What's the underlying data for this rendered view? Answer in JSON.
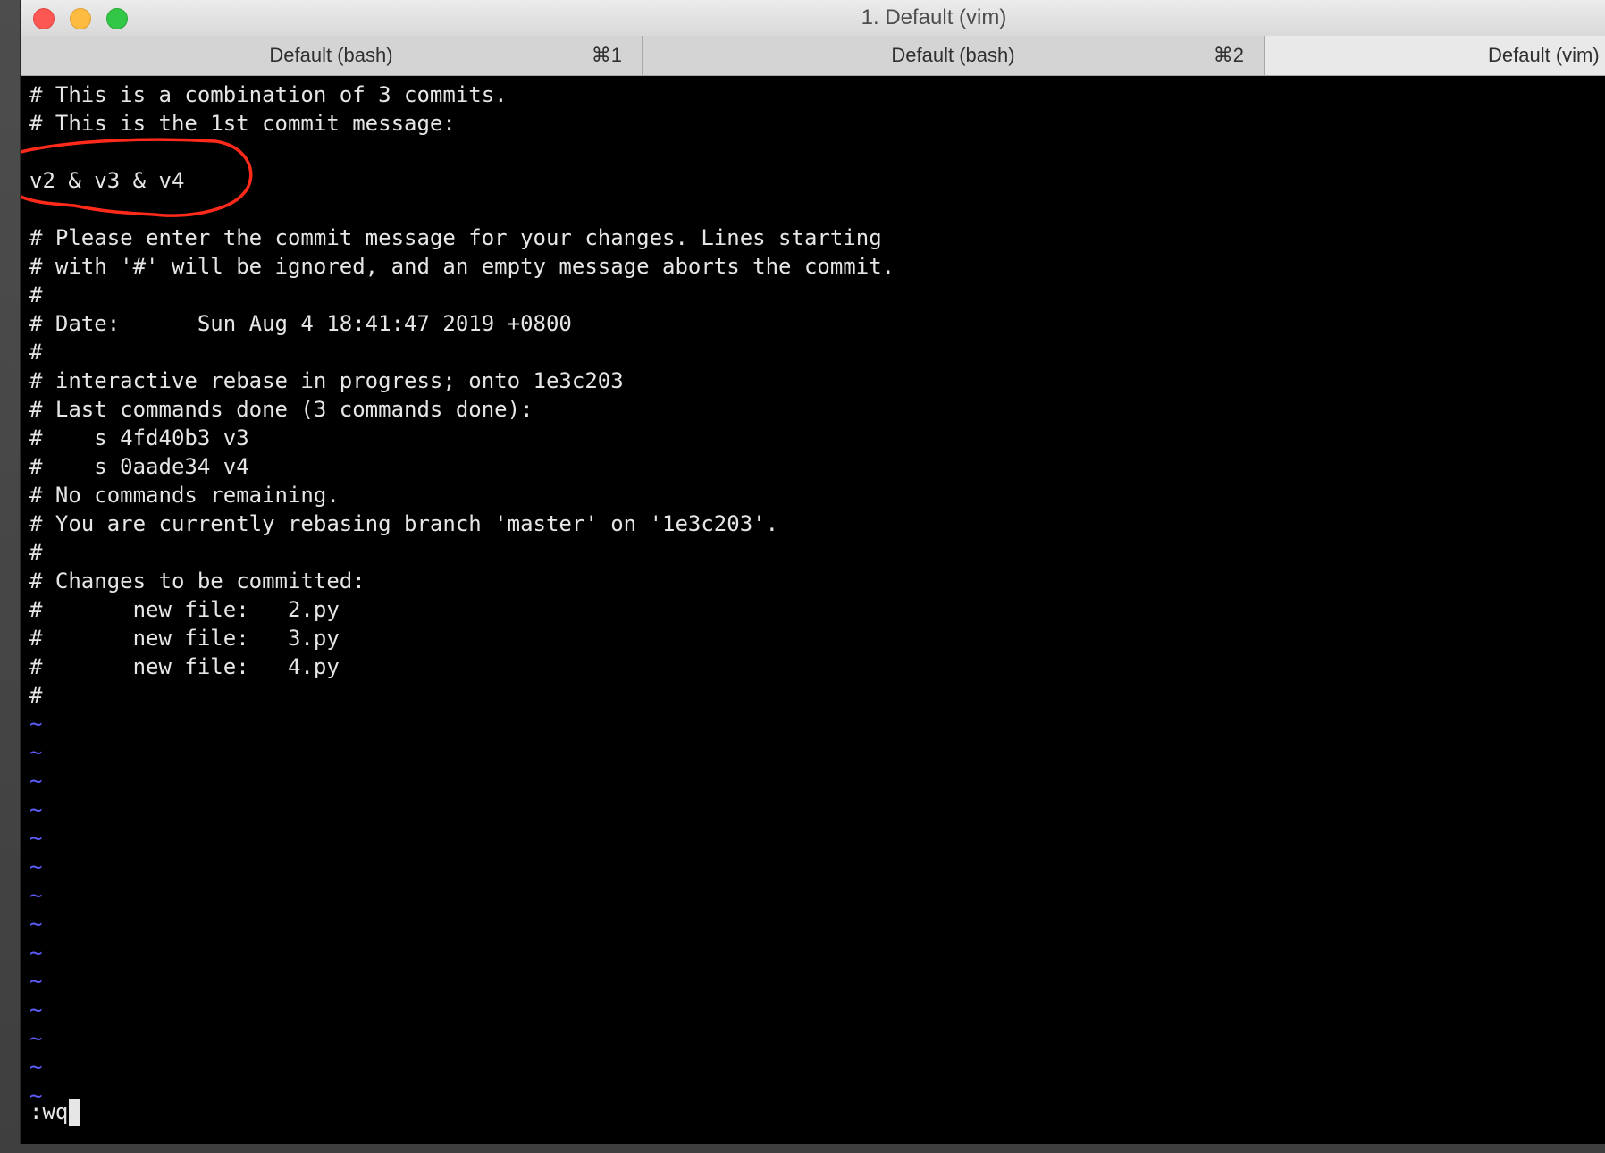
{
  "window": {
    "title": "1. Default (vim)"
  },
  "tabs": [
    {
      "label": "Default (bash)",
      "shortcut": "⌘1"
    },
    {
      "label": "Default (bash)",
      "shortcut": "⌘2"
    },
    {
      "label": "Default (vim)",
      "shortcut": ""
    }
  ],
  "editor": {
    "lines": [
      "# This is a combination of 3 commits.",
      "# This is the 1st commit message:",
      "",
      "v2 & v3 & v4",
      "",
      "# Please enter the commit message for your changes. Lines starting",
      "# with '#' will be ignored, and an empty message aborts the commit.",
      "#",
      "# Date:      Sun Aug 4 18:41:47 2019 +0800",
      "#",
      "# interactive rebase in progress; onto 1e3c203",
      "# Last commands done (3 commands done):",
      "#    s 4fd40b3 v3",
      "#    s 0aade34 v4",
      "# No commands remaining.",
      "# You are currently rebasing branch 'master' on '1e3c203'.",
      "#",
      "# Changes to be committed:",
      "#       new file:   2.py",
      "#       new file:   3.py",
      "#       new file:   4.py",
      "#"
    ],
    "tilde_lines": [
      "~",
      "~",
      "~",
      "~",
      "~",
      "~",
      "~",
      "~",
      "~",
      "~",
      "~",
      "~",
      "~",
      "~"
    ],
    "command_line": ":wq"
  },
  "colors": {
    "tilde": "#5c5cff",
    "annotation": "#ff2a1a",
    "text": "#e6e6e6",
    "background": "#000000"
  }
}
